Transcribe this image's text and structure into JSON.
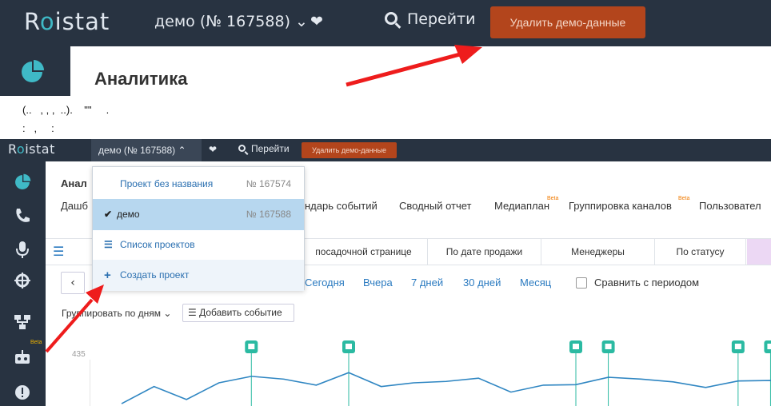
{
  "top": {
    "logo": "Roistat",
    "project": "демо  (№ 167588)",
    "chevron": "⌄",
    "heart": "❤",
    "go": "Перейти",
    "delete_demo": "Удалить демо-данные"
  },
  "page": {
    "title": "Аналитика",
    "note_line1": "(..   , , ,  ..).    \"\"     .",
    "note_line2": ":   ,     :"
  },
  "app": {
    "logo": "Roistat",
    "project": "демо  (№ 167588) ⌃",
    "heart": "❤",
    "go": "Перейти",
    "delete_demo": "Удалить демо-данные",
    "heading": "Анал",
    "dashboard_tab": "Дашб",
    "tabs": [
      "ндарь событий",
      "Сводный отчет",
      "Медиаплан",
      "Группировка каналов",
      "Пользовател"
    ],
    "beta": "Beta",
    "segments": [
      "посадочной странице",
      "По дате продажи",
      "Менеджеры",
      "По статусу"
    ],
    "prev": "‹",
    "date_links": [
      "Сегодня",
      "Вчера",
      "7 дней",
      "30 дней",
      "Месяц"
    ],
    "compare": "Сравнить с периодом",
    "group_by": "Группировать по дням ⌄",
    "add_event": "☰  Добавить событие",
    "y_tick": "435",
    "side_beta": "Beta"
  },
  "dropdown": {
    "items": [
      {
        "name": "Проект без названия",
        "num": "№ 167574"
      },
      {
        "name": "демо",
        "num": "№ 167588"
      },
      {
        "name": "Список проектов",
        "num": ""
      },
      {
        "name": "Создать проект",
        "num": ""
      }
    ],
    "check": "✔",
    "list_icon": "☰",
    "plus_icon": "+"
  },
  "chart_data": {
    "type": "line",
    "title": "",
    "y_ticks": [
      "435"
    ],
    "series": [
      {
        "values": [
          0.05,
          0.42,
          0.14,
          0.5,
          0.64,
          0.58,
          0.45,
          0.72,
          0.42,
          0.5,
          0.53,
          0.6,
          0.3,
          0.45,
          0.46,
          0.62,
          0.58,
          0.52,
          0.4,
          0.54,
          0.55,
          0.48
        ]
      }
    ]
  },
  "colors": {
    "topbar": "#283341",
    "accent": "#3fb9c6",
    "delete_button": "#b3451c",
    "link": "#2a7ac0",
    "arrow": "#ee1c1c",
    "line": "#2f86c2",
    "marker": "#2bbaa2"
  }
}
